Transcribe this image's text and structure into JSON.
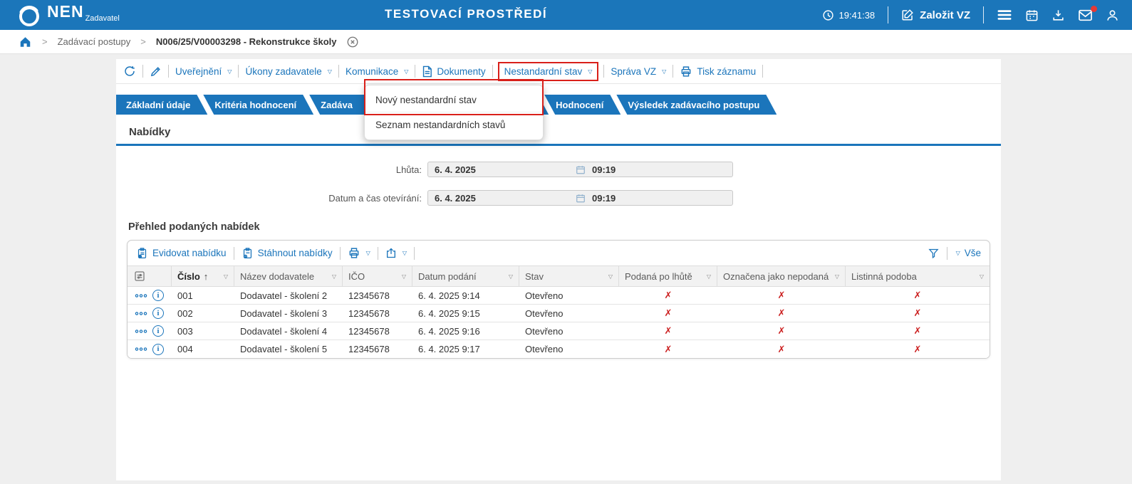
{
  "colors": {
    "accent_blue": "#1b75bb",
    "header_blue": "#1b76ba",
    "annotation_red": "#d9201a",
    "cross_red": "#cc2222",
    "notification_red": "#e53935",
    "tab_shadow": "#c2cfdb"
  },
  "icons": {
    "caret": "▽",
    "sort_asc": "↑",
    "chevron": ">",
    "info": "i"
  },
  "topbar": {
    "brand": "NEN",
    "brand_sub": "Zadavatel",
    "env_title": "TESTOVACÍ PROSTŘEDÍ",
    "clock": "19:41:38",
    "new_vz_label": "Založit VZ"
  },
  "breadcrumb": {
    "level1": "Zadávací postupy",
    "current": "N006/25/V00003298 - Rekonstrukce školy"
  },
  "toolbar": {
    "uverejneni": "Uveřejnění",
    "ukony_zadavatele": "Úkony zadavatele",
    "komunikace": "Komunikace",
    "dokumenty": "Dokumenty",
    "nestandardni_stav": "Nestandardní stav",
    "sprava_vz": "Správa VZ",
    "tisk_zaznamu": "Tisk záznamu"
  },
  "context_menu": {
    "novy": "Nový nestandardní stav",
    "seznam": "Seznam nestandardních stavů"
  },
  "tabs": {
    "zakladni": "Základní údaje",
    "kriteria": "Kritéria hodnocení",
    "zadavaci": "Zadáva",
    "hodnoceni": "Hodnocení",
    "vysledek": "Výsledek zadávacího postupu"
  },
  "offers": {
    "section_title": "Nabídky",
    "lhuta_label": "Lhůta:",
    "lhuta_date": "6. 4. 2025",
    "lhuta_time": "09:19",
    "otevirani_label": "Datum a čas otevírání:",
    "otevirani_date": "6. 4. 2025",
    "otevirani_time": "09:19"
  },
  "grid": {
    "title": "Přehled podaných nabídek",
    "evidovat": "Evidovat nabídku",
    "stahnout": "Stáhnout nabídky",
    "vse_label": "Vše",
    "columns": {
      "cislo": "Číslo",
      "nazev": "Název dodavatele",
      "ico": "IČO",
      "datum": "Datum podání",
      "stav": "Stav",
      "po_lhute": "Podaná po lhůtě",
      "nepodana": "Označena jako nepodaná",
      "listinna": "Listinná podoba"
    },
    "rows": [
      {
        "cislo": "001",
        "nazev": "Dodavatel - školení 2",
        "ico": "12345678",
        "datum": "6. 4. 2025 9:14",
        "stav": "Otevřeno",
        "po_lhute": "✗",
        "nepodana": "✗",
        "listinna": "✗"
      },
      {
        "cislo": "002",
        "nazev": "Dodavatel - školení 3",
        "ico": "12345678",
        "datum": "6. 4. 2025 9:15",
        "stav": "Otevřeno",
        "po_lhute": "✗",
        "nepodana": "✗",
        "listinna": "✗"
      },
      {
        "cislo": "003",
        "nazev": "Dodavatel - školení 4",
        "ico": "12345678",
        "datum": "6. 4. 2025 9:16",
        "stav": "Otevřeno",
        "po_lhute": "✗",
        "nepodana": "✗",
        "listinna": "✗"
      },
      {
        "cislo": "004",
        "nazev": "Dodavatel - školení 5",
        "ico": "12345678",
        "datum": "6. 4. 2025 9:17",
        "stav": "Otevřeno",
        "po_lhute": "✗",
        "nepodana": "✗",
        "listinna": "✗"
      }
    ]
  }
}
